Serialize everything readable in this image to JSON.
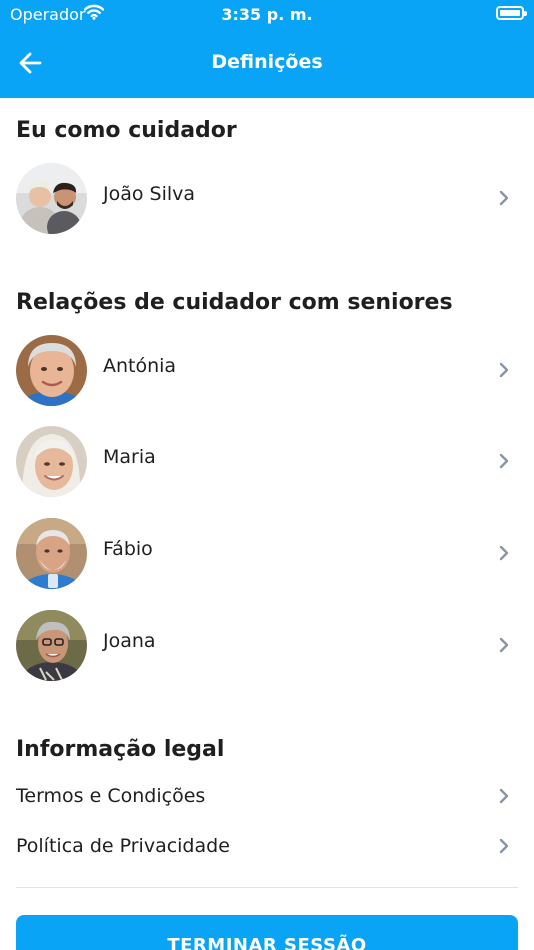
{
  "status_bar": {
    "carrier": "Operador",
    "time": "3:35 p. m."
  },
  "header": {
    "title": "Definições"
  },
  "caregiver_section": {
    "title": "Eu como cuidador",
    "profile": {
      "name": "João Silva"
    }
  },
  "relations_section": {
    "title": "Relações de cuidador com seniores",
    "seniors": [
      {
        "name": "Antónia"
      },
      {
        "name": "Maria"
      },
      {
        "name": "Fábio"
      },
      {
        "name": "Joana"
      }
    ]
  },
  "legal_section": {
    "title": "Informação legal",
    "links": [
      {
        "label": "Termos e Condições"
      },
      {
        "label": "Política de Privacidade"
      }
    ]
  },
  "logout_label": "TERMINAR SESSÃO",
  "colors": {
    "accent": "#0aa4f6",
    "chevron": "#8a94a6",
    "text": "#1f1f1f"
  }
}
